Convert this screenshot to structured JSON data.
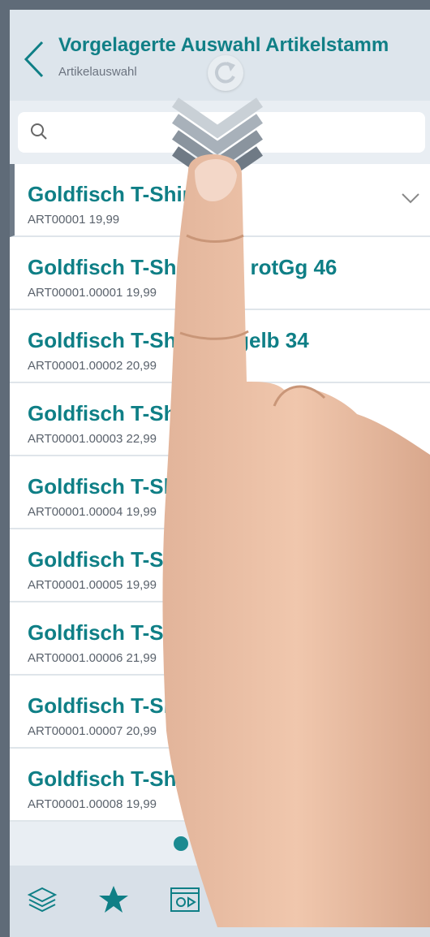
{
  "header": {
    "title": "Vorgelagerte Auswahl Artikelstamm",
    "subtitle": "Artikelauswahl"
  },
  "search": {
    "placeholder": "",
    "value": ""
  },
  "list": {
    "items": [
      {
        "title": "Goldfisch T-Shirt",
        "sub": "ART00001 19,99"
      },
      {
        "title": "Goldfisch T-Shirt XS - rotGg 46",
        "sub": "ART00001.00001 19,99"
      },
      {
        "title": "Goldfisch T-Shirt S - gelb 34",
        "sub": "ART00001.00002 20,99"
      },
      {
        "title": "Goldfisch T-Shirt S - blau Gg 32",
        "sub": "ART00001.00003 22,99"
      },
      {
        "title": "Goldfisch T-Shirt",
        "sub": "ART00001.00004 19,99"
      },
      {
        "title": "Goldfisch T-Shirt",
        "sub": "ART00001.00005 19,99"
      },
      {
        "title": "Goldfisch T-Shirt",
        "sub": "ART00001.00006 21,99"
      },
      {
        "title": "Goldfisch T-Shirt",
        "sub": "ART00001.00007 20,99"
      },
      {
        "title": "Goldfisch T-Shirt",
        "sub": "ART00001.00008 19,99"
      }
    ]
  },
  "pager": {
    "pages": 3,
    "active": 1
  },
  "icons": {
    "back": "chevron-left-icon",
    "search": "search-icon",
    "refresh": "refresh-icon",
    "expand": "chevron-down-icon",
    "toolbar": [
      "layers-icon",
      "star-icon",
      "settings-card-icon",
      "clipboard-icon"
    ]
  },
  "colors": {
    "accent": "#0f7f86",
    "header_bg": "#dde5ec",
    "toolbar_bg": "#d8e0e8"
  }
}
